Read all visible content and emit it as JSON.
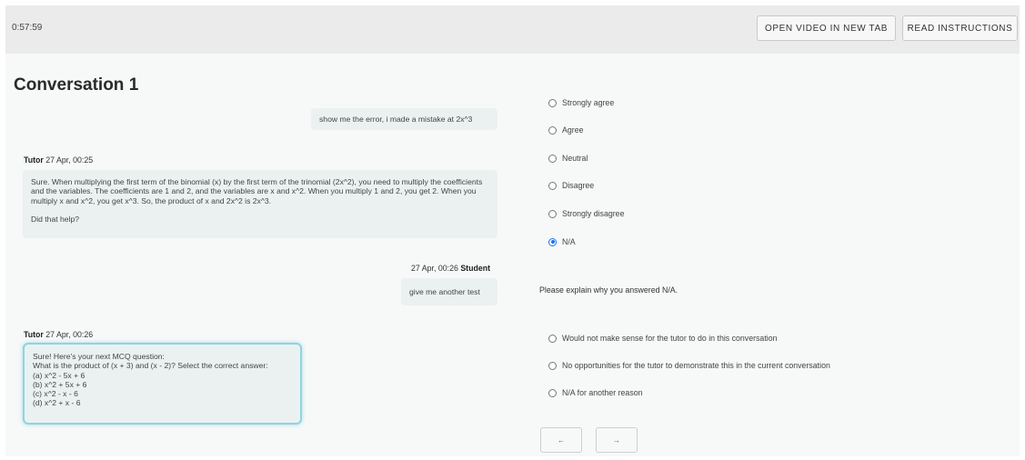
{
  "header": {
    "timer": "0:57:59",
    "open_video_label": "OPEN VIDEO IN NEW TAB",
    "read_instructions_label": "READ INSTRUCTIONS"
  },
  "conversation": {
    "title": "Conversation 1",
    "messages": [
      {
        "role": "student",
        "text": "show me the error, i made a mistake at 2x^3"
      },
      {
        "role": "tutor",
        "author": "Tutor",
        "time": "27 Apr, 00:25",
        "paragraphs": [
          "Sure. When multiplying the first term of the binomial (x) by the first term of the trinomial (2x^2), you need to multiply the coefficients and the variables. The coefficients are 1 and 2, and the variables are x and x^2. When you multiply 1 and 2, you get 2. When you multiply x and x^2, you get x^3. So, the product of x and 2x^2 is 2x^3.",
          "Did that help?"
        ]
      },
      {
        "role": "student",
        "author": "Student",
        "time": "27 Apr, 00:26",
        "text": "give me another test"
      },
      {
        "role": "tutor",
        "author": "Tutor",
        "time": "27 Apr, 00:26",
        "lines": [
          "Sure! Here's your next MCQ question:",
          "What is the product of (x + 3) and (x - 2)? Select the correct answer:",
          "(a) x^2 - 5x + 6",
          "(b) x^2 + 5x + 6",
          "(c) x^2 - x - 6",
          "(d) x^2 + x - 6"
        ]
      }
    ]
  },
  "rating": {
    "options": [
      "Strongly agree",
      "Agree",
      "Neutral",
      "Disagree",
      "Strongly disagree",
      "N/A"
    ],
    "selected": "N/A"
  },
  "explanation": {
    "prompt": "Please explain why you answered N/A.",
    "options": [
      "Would not make sense for the tutor to do in this conversation",
      "No opportunities for the tutor to demonstrate this in the current conversation",
      "N/A for another reason"
    ]
  },
  "nav": {
    "prev_label": "←",
    "next_label": "→"
  }
}
